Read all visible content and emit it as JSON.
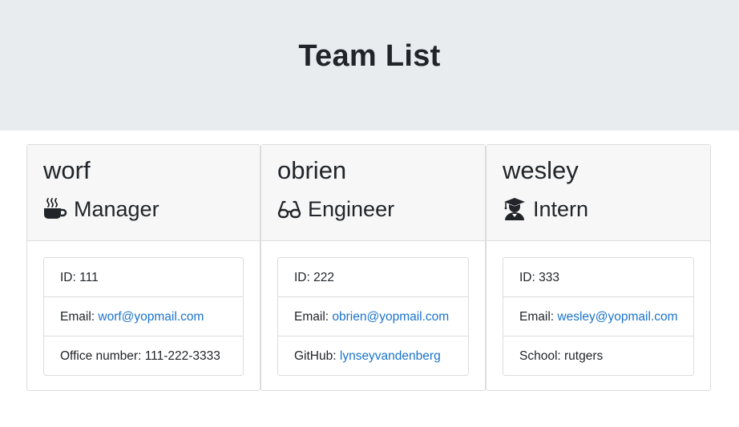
{
  "header": {
    "title": "Team List"
  },
  "cards": [
    {
      "name": "worf",
      "role": "Manager",
      "role_icon": "mug-hot-icon",
      "id_label": "ID:",
      "id_value": "111",
      "email_label": "Email:",
      "email": "worf@yopmail.com",
      "extra_label": "Office number:",
      "extra_value": "111-222-3333"
    },
    {
      "name": "obrien",
      "role": "Engineer",
      "role_icon": "glasses-icon",
      "id_label": "ID:",
      "id_value": "222",
      "email_label": "Email:",
      "email": "obrien@yopmail.com",
      "extra_label": "GitHub:",
      "extra_value": "lynseyvandenberg"
    },
    {
      "name": "wesley",
      "role": "Intern",
      "role_icon": "user-graduate-icon",
      "id_label": "ID:",
      "id_value": "333",
      "email_label": "Email:",
      "email": "wesley@yopmail.com",
      "extra_label": "School:",
      "extra_value": "rutgers"
    }
  ],
  "colors": {
    "jumbotron_bg": "#e9ecef",
    "link": "#1a73c9",
    "card_header_bg": "#f7f7f7"
  }
}
